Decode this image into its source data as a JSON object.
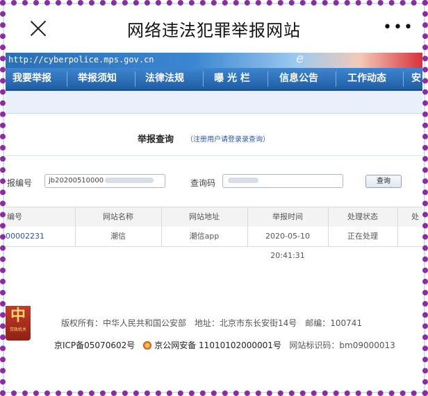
{
  "app": {
    "title": "网络违法犯罪举报网站",
    "more_glyph": "•••"
  },
  "banner": {
    "url": "http://cyberpolice.mps.gov.cn",
    "mark": "e"
  },
  "nav": {
    "items": [
      {
        "label": "我要举报"
      },
      {
        "label": "举报须知"
      },
      {
        "label": "法律法规"
      },
      {
        "label": "曝 光 栏"
      },
      {
        "label": "信息公告"
      },
      {
        "label": "工作动态"
      },
      {
        "label": "安"
      }
    ]
  },
  "query": {
    "title": "举报查询",
    "note": "（注册用户请登录录查询）",
    "report_no_label": "报编号",
    "report_no_value": "jb20200510000",
    "code_label": "查询码",
    "code_value": "",
    "button_label": "查询"
  },
  "table": {
    "headers": [
      "编号",
      "网站名称",
      "网站地址",
      "举报时间",
      "处理状态",
      "处"
    ],
    "rows": [
      [
        "00002231",
        "潮信",
        "潮信app",
        "2020-05-10 20:41:31",
        "正在处理",
        ""
      ]
    ]
  },
  "footer": {
    "line1": "版权所有：中华人民共和国公安部　地址：北京市东长安街14号　邮编：100741",
    "icp": "京ICP备05070602号",
    "police_record": "京公网安备 11010102000001号",
    "site_id": "网站标识码：bm09000013",
    "emblem_glyph": "中",
    "emblem_text": "党政机关"
  },
  "colors": {
    "frame": "#8e2aa3",
    "nav_bg": "#1f5ea6",
    "link": "#2a56b0"
  }
}
